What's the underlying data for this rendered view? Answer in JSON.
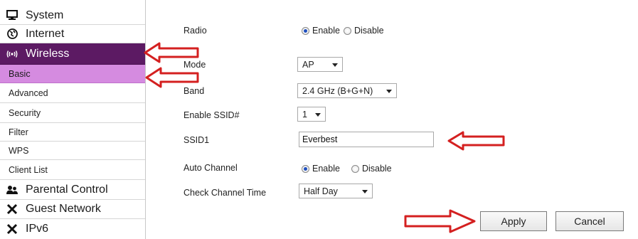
{
  "sidebar": {
    "items": [
      {
        "label": "System",
        "icon": "monitor-icon"
      },
      {
        "label": "Internet",
        "icon": "globe-icon"
      },
      {
        "label": "Wireless",
        "icon": "wireless-icon"
      },
      {
        "label": "Basic"
      },
      {
        "label": "Advanced"
      },
      {
        "label": "Security"
      },
      {
        "label": "Filter"
      },
      {
        "label": "WPS"
      },
      {
        "label": "Client List"
      },
      {
        "label": "Parental Control",
        "icon": "users-icon"
      },
      {
        "label": "Guest Network",
        "icon": "tools-icon"
      },
      {
        "label": "IPv6",
        "icon": "tools-icon"
      }
    ]
  },
  "form": {
    "radio_label": "Radio",
    "radio_enable": "Enable",
    "radio_disable": "Disable",
    "mode_label": "Mode",
    "mode_value": "AP",
    "band_label": "Band",
    "band_value": "2.4 GHz (B+G+N)",
    "enable_ssid_label": "Enable SSID#",
    "enable_ssid_value": "1",
    "ssid1_label": "SSID1",
    "ssid1_value": "Everbest",
    "auto_channel_label": "Auto Channel",
    "auto_channel_enable": "Enable",
    "auto_channel_disable": "Disable",
    "check_channel_label": "Check Channel Time",
    "check_channel_value": "Half Day"
  },
  "buttons": {
    "apply": "Apply",
    "cancel": "Cancel"
  },
  "colors": {
    "active_parent": "#5c1a63",
    "active_sub": "#d58be0",
    "arrow": "#d42020"
  }
}
